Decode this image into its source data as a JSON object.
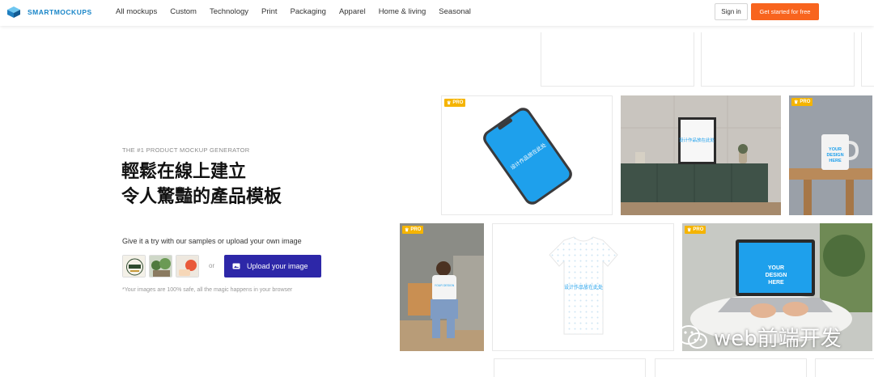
{
  "header": {
    "brand": "SMARTMOCKUPS",
    "nav": [
      "All mockups",
      "Custom",
      "Technology",
      "Print",
      "Packaging",
      "Apparel",
      "Home & living",
      "Seasonal"
    ],
    "signin": "Sign in",
    "cta": "Get started for free",
    "accent": "#f8641e",
    "brand_color": "#1a86c8"
  },
  "hero": {
    "eyebrow": "THE #1 PRODUCT MOCKUP GENERATOR",
    "headline_line1": "輕鬆在線上建立",
    "headline_line2": "令人驚豔的產品模板",
    "try_text": "Give it a try with our samples or upload your own image",
    "or": "or",
    "upload_label": "Upload your image",
    "upload_color": "#2d27a8",
    "safe_text": "*Your images are 100% safe, all the magic happens in your browser"
  },
  "mockups": {
    "pro_label": "PRO",
    "phone_screen_text": "设计作品放在此处",
    "frame_text": "设计作品放在此处",
    "mug_text": [
      "YOUR",
      "DESIGN",
      "HERE"
    ],
    "tshirt_text": "设计作品放在此处",
    "laptop_text": [
      "YOUR",
      "DESIGN",
      "HERE"
    ],
    "person_shirt_text": "YOUR DESIGN"
  },
  "watermark": {
    "text": "web前端开发"
  }
}
